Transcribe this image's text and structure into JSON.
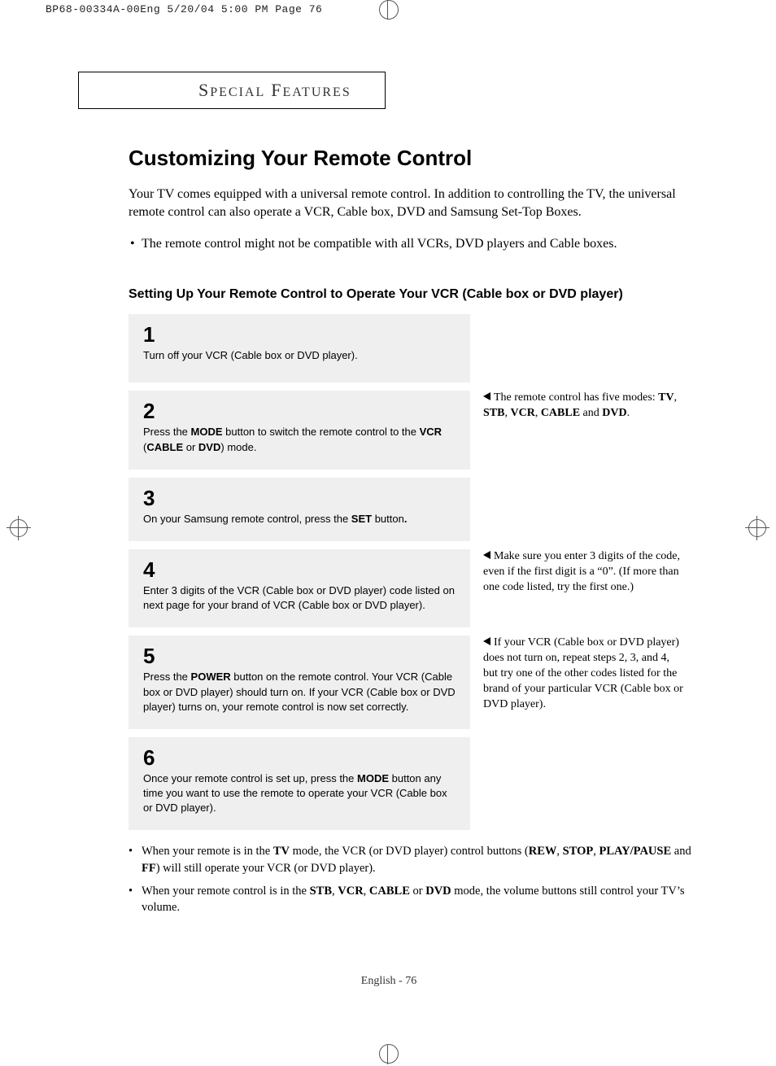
{
  "preprint": "BP68-00334A-00Eng  5/20/04  5:00 PM  Page 76",
  "section_header": "SPECIAL FEATURES",
  "title": "Customizing Your Remote Control",
  "intro": "Your TV comes equipped with a universal remote control. In addition to controlling the TV, the universal remote control can also operate a VCR, Cable box, DVD and Samsung Set-Top Boxes.",
  "intro_bullet": "The remote control might not be compatible with all VCRs, DVD players and Cable boxes.",
  "subheading": "Setting Up Your Remote Control to Operate Your VCR (Cable box or DVD player)",
  "steps": [
    {
      "num": "1",
      "text": "Turn off your VCR (Cable box or DVD player).",
      "note_html": ""
    },
    {
      "num": "2",
      "text_html": "Press the <b>MODE</b> button to switch the remote control to the <b>VCR</b> (<b>CABLE</b> or <b>DVD</b>) mode.",
      "note_html": "The remote control has five modes: <b>TV</b>, <b>STB</b>, <b>VCR</b>, <b>CABLE</b> and <b>DVD</b>."
    },
    {
      "num": "3",
      "text_html": "On your Samsung remote control, press the <b>SET</b> button<b>.</b>",
      "note_html": ""
    },
    {
      "num": "4",
      "text_html": "Enter 3 digits of the VCR (Cable box or DVD player) code listed on next page for your brand of VCR (Cable box or DVD player).",
      "note_html": "Make sure you enter 3 digits of the code, even if the first digit is a “0”. (If more than one code listed, try the first one.)"
    },
    {
      "num": "5",
      "text_html": "Press the <b>POWER</b> button on the remote control. Your VCR (Cable box or DVD player) should turn on. If your VCR (Cable box or DVD player) turns on, your remote control is now set correctly.",
      "note_html": "If your VCR (Cable box or DVD player) does not turn on, repeat steps 2, 3, and 4, but try one of the other codes listed for the brand of your particular VCR (Cable box or DVD player)."
    },
    {
      "num": "6",
      "text_html": "Once your remote control is set up, press the <b>MODE</b> button any time you want to use the remote to operate your VCR (Cable box or DVD player).",
      "note_html": ""
    }
  ],
  "footer_bullets": [
    "When your remote is in the <b>TV</b> mode, the VCR (or DVD player) control buttons (<b>REW</b>, <b>STOP</b>, <b>PLAY/PAUSE</b> and <b>FF</b>) will still operate your VCR (or DVD player).",
    "When your remote control is in the <b>STB</b>, <b>VCR</b>, <b>CABLE</b> or <b>DVD</b> mode, the volume buttons still control your TV’s volume."
  ],
  "page_number": "English - 76"
}
